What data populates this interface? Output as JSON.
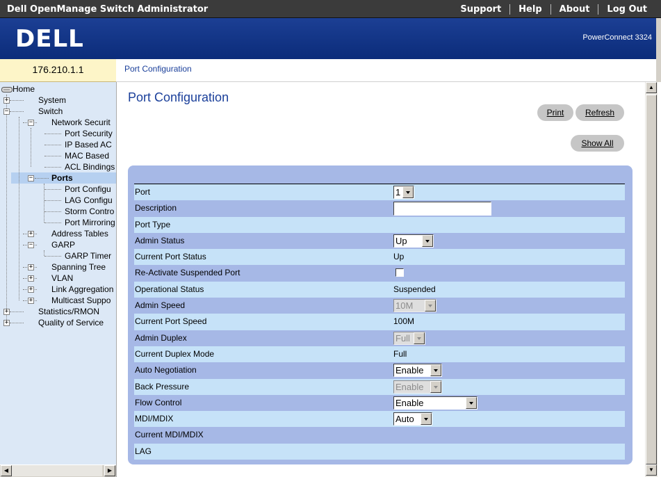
{
  "header": {
    "app_title": "Dell OpenManage Switch Administrator",
    "links": [
      "Support",
      "Help",
      "About",
      "Log Out"
    ],
    "logo_text": "DELL",
    "product": "PowerConnect 3324"
  },
  "address": {
    "ip": "176.210.1.1",
    "breadcrumb": "Port Configuration"
  },
  "sidebar": {
    "home": "Home",
    "system": "System",
    "switch": "Switch",
    "network_security": "Network Securit",
    "port_security": "Port Security",
    "ip_based_acl": "IP Based AC",
    "mac_based_acl": "MAC Based",
    "acl_bindings": "ACL Bindings",
    "ports": "Ports",
    "port_config": "Port Configu",
    "lag_config": "LAG Configu",
    "storm_control": "Storm Contro",
    "port_mirroring": "Port Mirroring",
    "address_tables": "Address Tables",
    "garp": "GARP",
    "garp_timers": "GARP Timer",
    "spanning_tree": "Spanning Tree",
    "vlan": "VLAN",
    "link_aggregation": "Link Aggregation",
    "multicast_support": "Multicast Suppo",
    "statistics_rmon": "Statistics/RMON",
    "quality_of_service": "Quality of Service"
  },
  "main": {
    "title": "Port Configuration",
    "print_label": "Print",
    "refresh_label": "Refresh",
    "show_all_label": "Show All"
  },
  "form": {
    "port_label": "Port",
    "port_value": "1",
    "description_label": "Description",
    "description_value": "",
    "port_type_label": "Port Type",
    "admin_status_label": "Admin Status",
    "admin_status_value": "Up",
    "current_port_status_label": "Current Port Status",
    "current_port_status_value": "Up",
    "reactivate_label": "Re-Activate Suspended Port",
    "operational_status_label": "Operational Status",
    "operational_status_value": "Suspended",
    "admin_speed_label": "Admin Speed",
    "admin_speed_value": "10M",
    "current_port_speed_label": "Current Port Speed",
    "current_port_speed_value": "100M",
    "admin_duplex_label": "Admin Duplex",
    "admin_duplex_value": "Full",
    "current_duplex_label": "Current Duplex Mode",
    "current_duplex_value": "Full",
    "auto_negotiation_label": "Auto Negotiation",
    "auto_negotiation_value": "Enable",
    "back_pressure_label": "Back Pressure",
    "back_pressure_value": "Enable",
    "flow_control_label": "Flow Control",
    "flow_control_value": "Enable",
    "mdi_label": "MDI/MDIX",
    "mdi_value": "Auto",
    "current_mdi_label": "Current MDI/MDIX",
    "lag_label": "LAG"
  },
  "colors": {
    "topbar": "#3b3b3b",
    "brand": "#0b2c7a",
    "link_blue": "#1a3f9a",
    "sidebar_bg": "#dce8f6",
    "panel": "#a6b8e6",
    "row_light": "#c6e2f8"
  }
}
